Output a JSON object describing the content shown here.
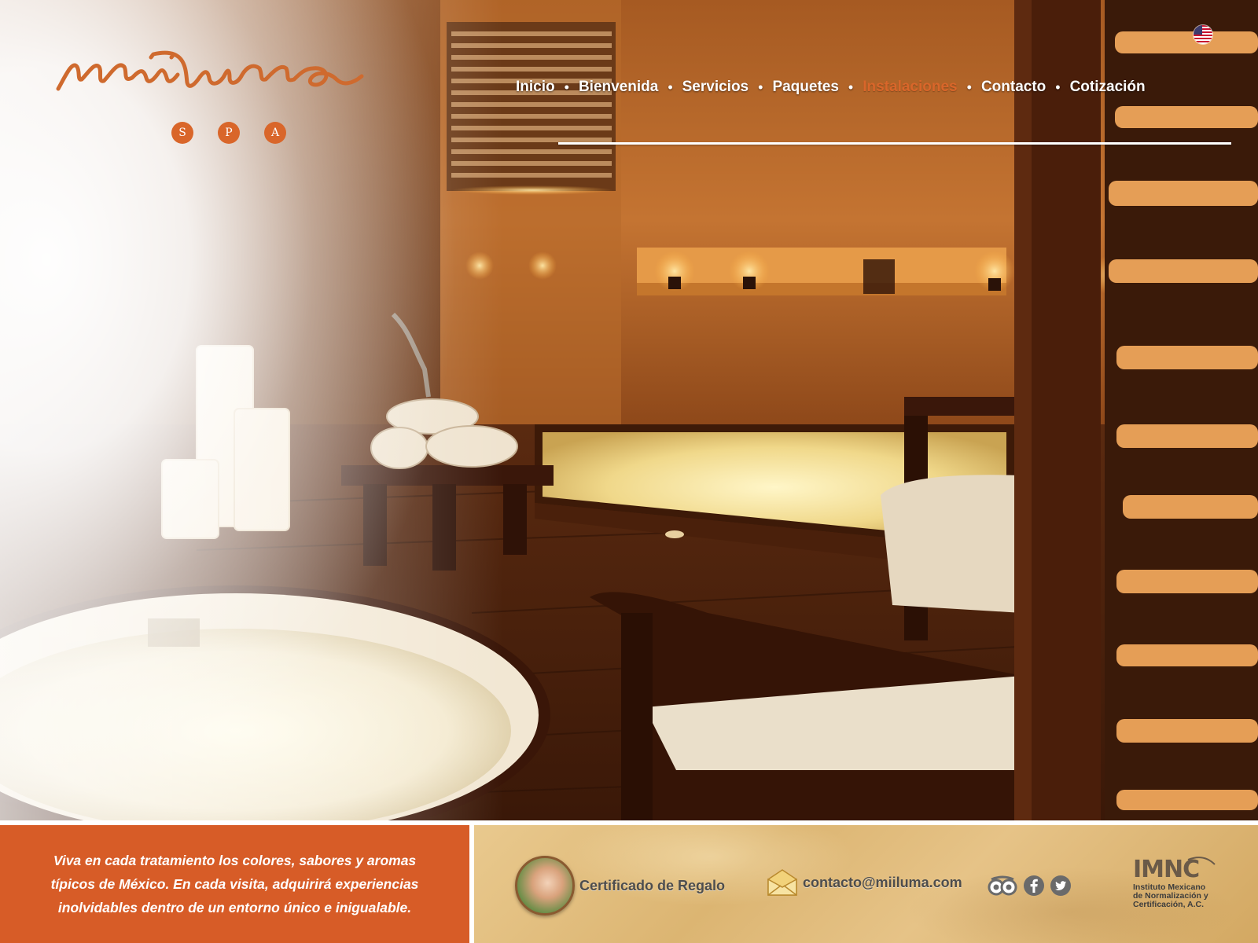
{
  "brand": {
    "logo_text": "miiluma",
    "subtitle_letters": [
      "S",
      "P",
      "A"
    ],
    "accent_color": "#d9662a"
  },
  "language_switch": {
    "icon": "us-flag-icon"
  },
  "nav": {
    "items": [
      {
        "label": "Inicio"
      },
      {
        "label": "Bienvenida"
      },
      {
        "label": "Servicios"
      },
      {
        "label": "Paquetes"
      },
      {
        "label": "Instalaciones",
        "active": true
      },
      {
        "label": "Contacto"
      },
      {
        "label": "Cotización"
      }
    ],
    "separator": "•",
    "active_color": "#d9662a"
  },
  "footer": {
    "tagline_lines": [
      "Viva en cada tratamiento los colores, sabores y aromas",
      "típicos de México. En cada visita, adquirirá experiencias",
      "inolvidables dentro de un entorno único e inigualable."
    ],
    "tagline_bg": "#d75c27",
    "gift_label": "Certificado de Regalo",
    "email": "contacto@miiluma.com",
    "social_icons": [
      "tripadvisor-icon",
      "facebook-icon",
      "twitter-icon"
    ],
    "certification": {
      "acronym": "IMNC",
      "lines": [
        "Instituto Mexicano",
        "de Normalización y",
        "Certificación, A.C."
      ]
    }
  }
}
